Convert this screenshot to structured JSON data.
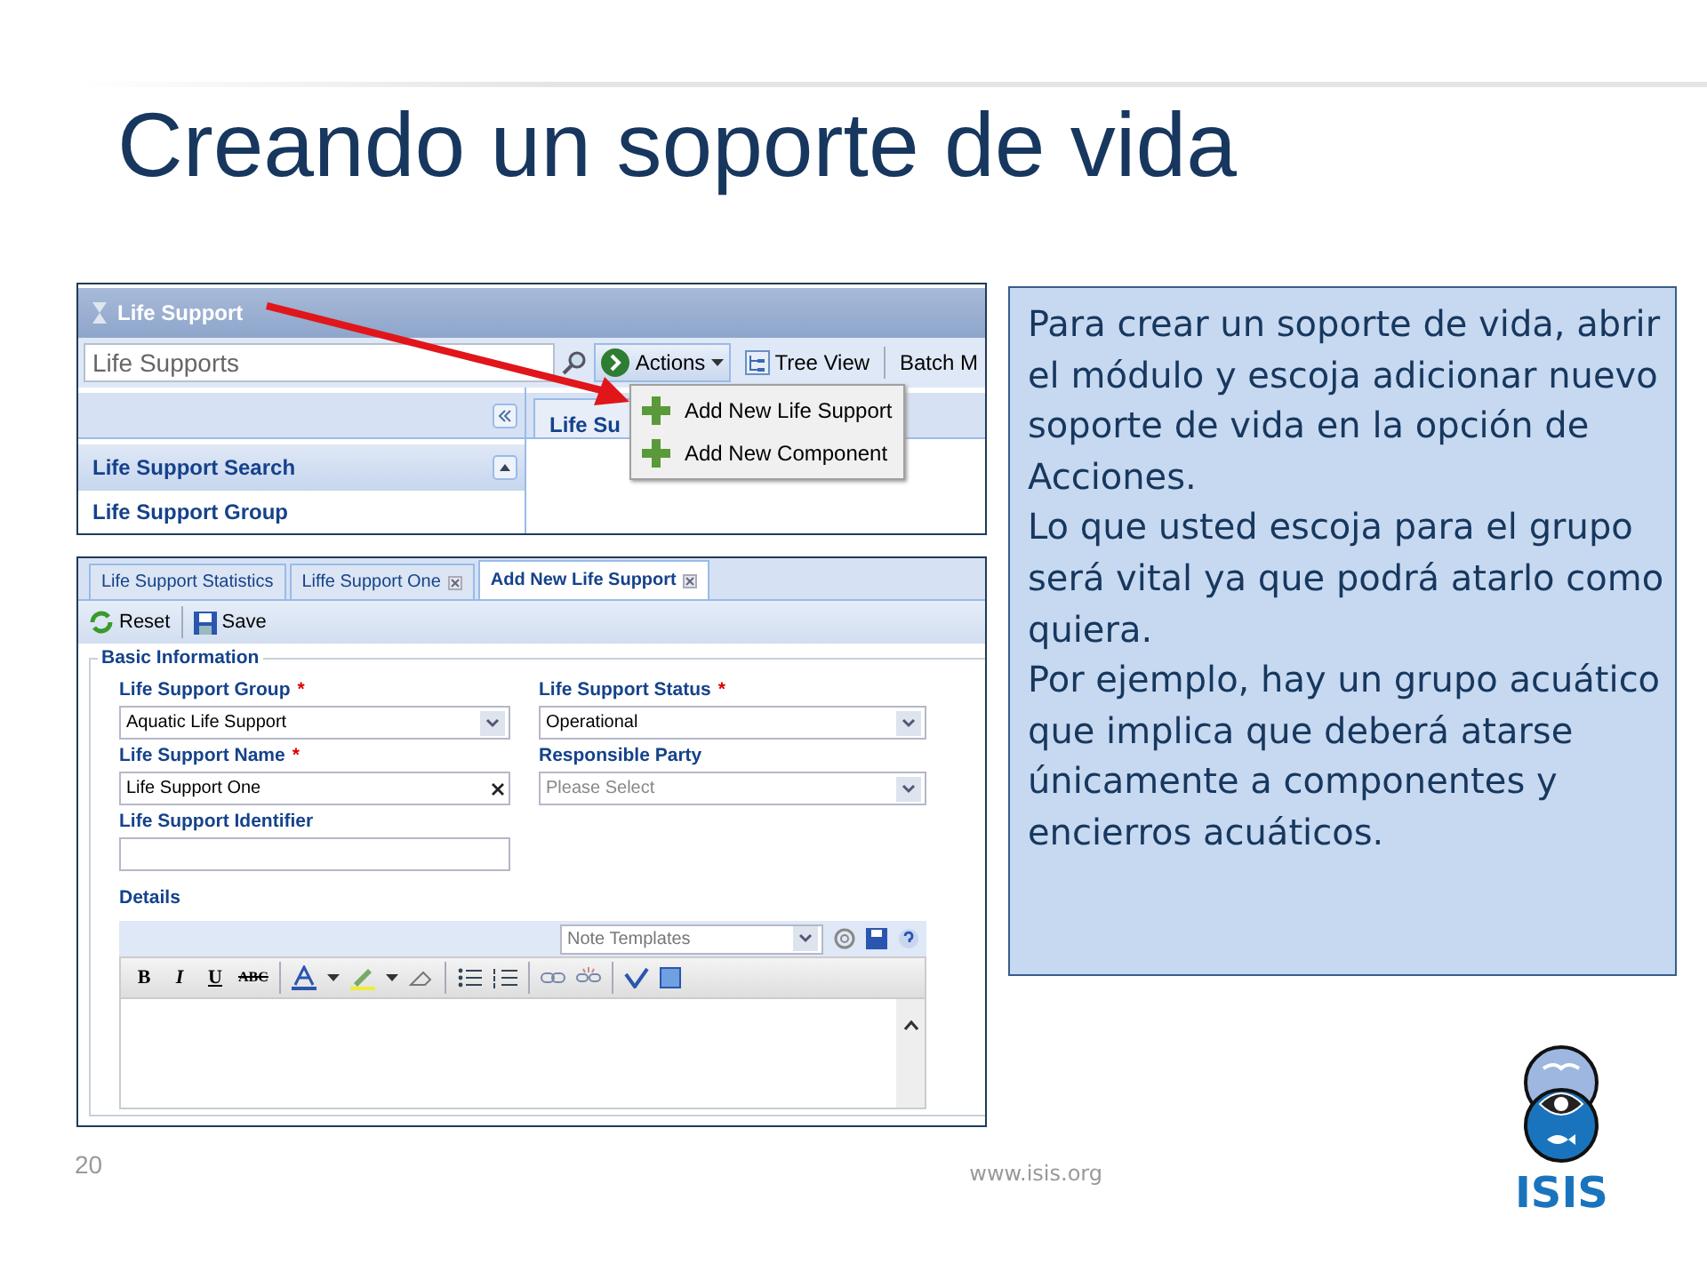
{
  "title": "Creando un soporte de vida",
  "screenshot_top": {
    "window_title": "Life Support",
    "search": {
      "placeholder": "Life Supports"
    },
    "toolbar": [
      {
        "kind": "menu",
        "label": "Actions"
      },
      {
        "kind": "view",
        "label": "Tree View"
      },
      {
        "kind": "plain",
        "label": "Batch M"
      }
    ],
    "menu": {
      "items": [
        "Add New Life Support",
        "Add New Component"
      ]
    },
    "tab": "Life Su",
    "sidebar": {
      "items": [
        {
          "kind": "header",
          "label": "Life Support Search"
        },
        {
          "kind": "item",
          "label": "Life Support Group"
        }
      ]
    }
  },
  "screenshot_form": {
    "tabs": [
      {
        "label": "Life Support Statistics",
        "selected": false,
        "closable": false
      },
      {
        "label": "Liffe Support One",
        "selected": false,
        "closable": true
      },
      {
        "label": "Add New Life Support",
        "selected": true,
        "closable": true
      }
    ],
    "toolbar": [
      {
        "kind": "reset",
        "label": "Reset"
      },
      {
        "kind": "save",
        "label": "Save"
      }
    ],
    "fieldset": "Basic Information",
    "fields": [
      {
        "kind": "select",
        "label": "Life Support Group",
        "required_mark": "*",
        "value": "Aquatic Life Support"
      },
      {
        "kind": "select",
        "label": "Life Support Status",
        "required_mark": "*",
        "value": "Operational"
      },
      {
        "kind": "text",
        "label": "Life Support Name",
        "required_mark": "*",
        "value": "Life Support One"
      },
      {
        "kind": "select",
        "label": "Responsible Party",
        "placeholder": "Please Select"
      },
      {
        "kind": "text",
        "label": "Life Support Identifier"
      }
    ],
    "details": {
      "label": "Details",
      "templates": {
        "placeholder": "Note Templates"
      },
      "format_buttons": [
        "B",
        "I",
        "U",
        "ABC"
      ]
    }
  },
  "callout": {
    "paragraphs": [
      "Para crear un soporte de vida, abrir el módulo y escoja adicionar nuevo soporte de vida en la opción de Acciones.",
      "Lo que usted escoja para el grupo será vital ya que podrá atarlo como quiera.",
      "Por ejemplo, hay un grupo acuático que implica que deberá atarse  únicamente a componentes y encierros acuáticos."
    ]
  },
  "footer": {
    "page": "20",
    "url": "www.isis.org"
  },
  "logo": {
    "text": "ISIS"
  }
}
